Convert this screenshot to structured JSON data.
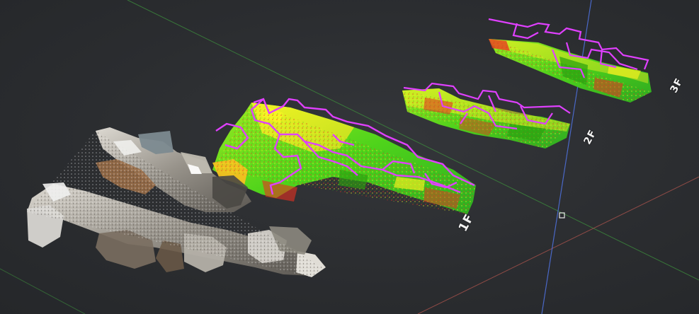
{
  "viewer": {
    "floors": [
      {
        "id": "1F",
        "label": "1F"
      },
      {
        "id": "2F",
        "label": "2F"
      },
      {
        "id": "3F",
        "label": "3F"
      }
    ]
  },
  "colors": {
    "background": "#2b2d30",
    "grid_line": "#3c6e3c",
    "axis_x": "#a0504a",
    "axis_y": "#4e6fd8",
    "axis_ground": "#3c8a3c",
    "path": "#e040ff",
    "cloud_green": "#66e020",
    "cloud_yellow": "#f0f020",
    "cloud_red": "#e83020",
    "cloud_gray": "#c8c4bc"
  },
  "icons": {
    "origin": "origin-gizmo-icon"
  }
}
